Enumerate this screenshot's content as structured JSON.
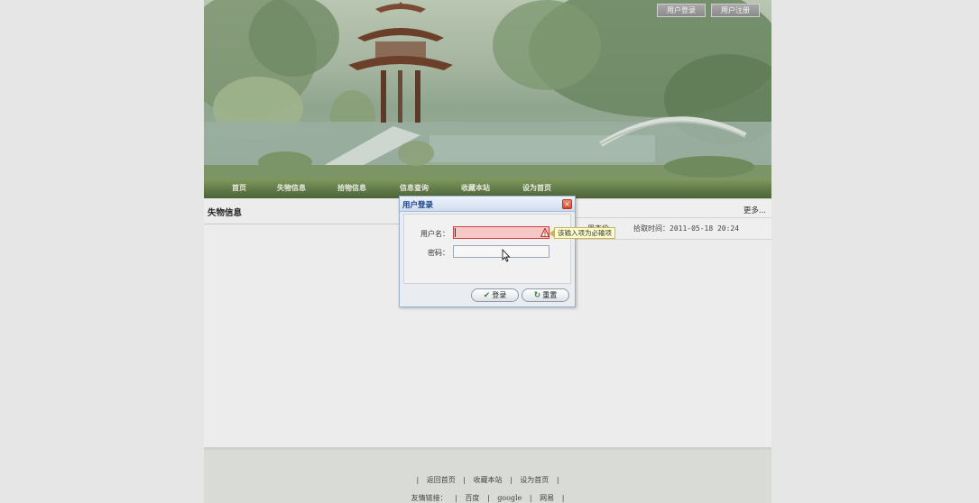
{
  "header": {
    "login_button": "用户登录",
    "register_button": "用户注册"
  },
  "nav": {
    "items": [
      "首页",
      "失物信息",
      "拾物信息",
      "信息查询",
      "收藏本站",
      "设为首页"
    ]
  },
  "main": {
    "left_panel_title": "失物信息",
    "more_link": "更多...",
    "right_row": {
      "name": "周杰伦",
      "time": "拾取时间：2011-05-18 20:24"
    }
  },
  "dialog": {
    "title": "用户登录",
    "close_glyph": "×",
    "username_label": "用户名：",
    "password_label": "密码：",
    "username_value": "",
    "password_value": "",
    "submit_label": "登录",
    "reset_label": "重置",
    "tooltip": "该输入项为必输项"
  },
  "footer": {
    "links": [
      "返回首页",
      "收藏本站",
      "设为首页"
    ],
    "friend_label": "友情链接：",
    "friend_links": [
      "百度",
      "google",
      "网易"
    ]
  },
  "colors": {
    "nav_bg": "#5f7746",
    "error_field": "#f6c7c7",
    "dialog_title": "#15428b"
  }
}
